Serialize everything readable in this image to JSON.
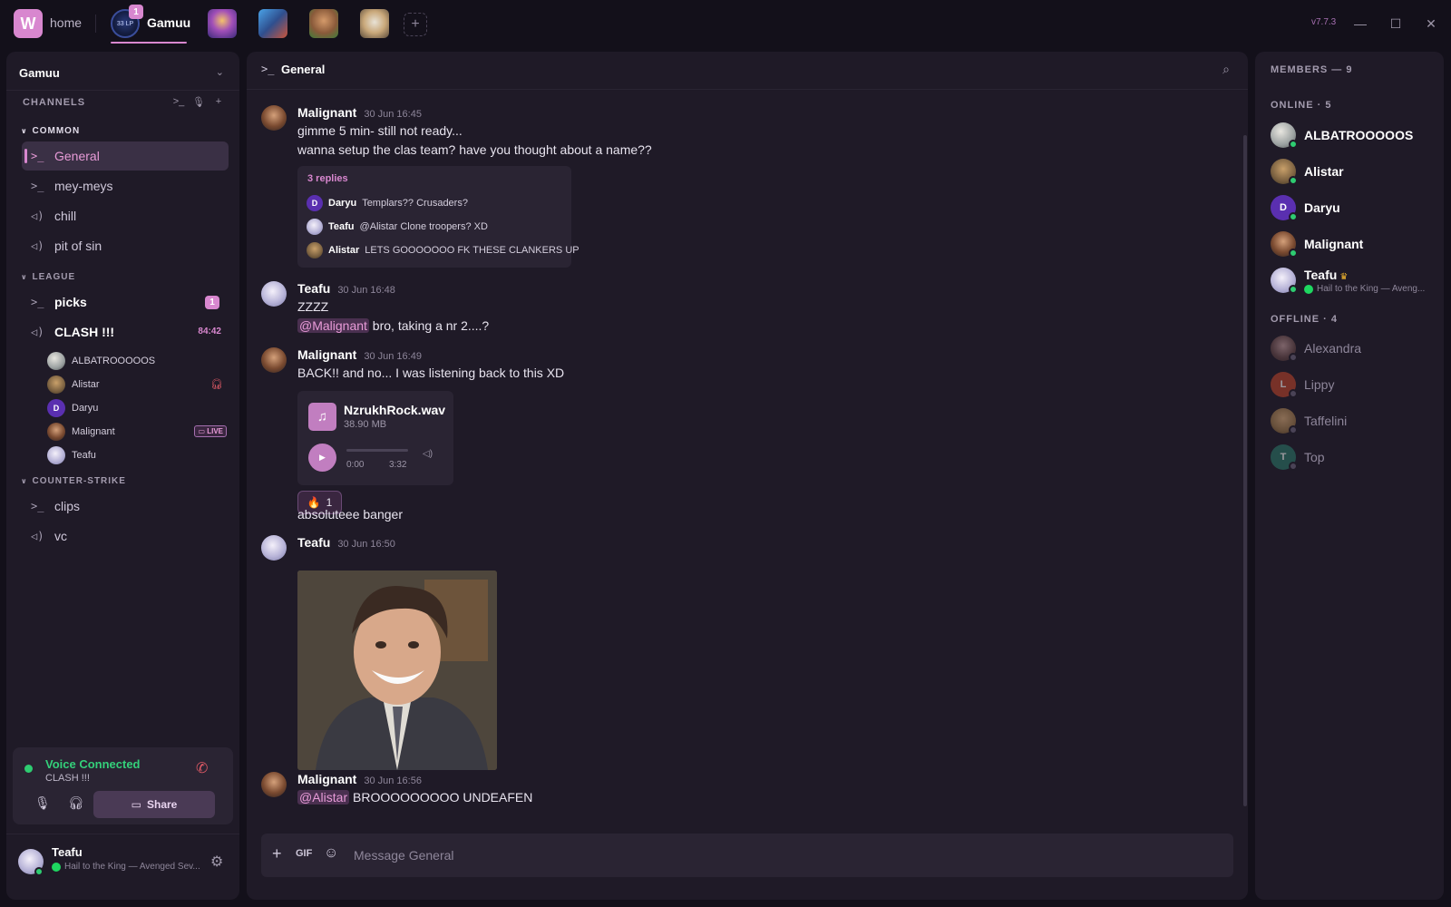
{
  "titlebar": {
    "logo_letter": "W",
    "home_label": "home",
    "active_server": {
      "name": "Gamuu",
      "badge": "1",
      "icon_text": "33 LP"
    },
    "other_servers": [
      "server-2",
      "server-3",
      "server-4",
      "server-5"
    ],
    "add_server": "+",
    "version": "v7.7.3",
    "minimize": "—",
    "maximize": "☐",
    "close": "✕"
  },
  "sidebar": {
    "server_name": "Gamuu",
    "channels_header": "CHANNELS",
    "categories": [
      {
        "name": "COMMON"
      },
      {
        "name": "LEAGUE"
      },
      {
        "name": "COUNTER-STRIKE"
      }
    ],
    "channels": {
      "general": "General",
      "meymeys": "mey-meys",
      "chill": "chill",
      "pitofsin": "pit of sin",
      "picks": "picks",
      "picks_badge": "1",
      "clash": "CLASH !!!",
      "clash_timer": "84:42",
      "clips": "clips",
      "vc": "vc"
    },
    "voice_members": [
      {
        "name": "ALBATROOOOOS"
      },
      {
        "name": "Alistar",
        "status": "deafened"
      },
      {
        "name": "Daryu",
        "initial": "D"
      },
      {
        "name": "Malignant",
        "badge": "LIVE"
      },
      {
        "name": "Teafu"
      }
    ],
    "voice": {
      "status": "Voice Connected",
      "channel": "CLASH !!!",
      "share_label": "Share"
    },
    "user": {
      "name": "Teafu",
      "activity": "Hail to the King — Avenged Sev..."
    }
  },
  "main": {
    "channel_name": "General",
    "messages": [
      {
        "author": "Malignant",
        "date": "30 Jun 16:45",
        "lines": [
          "gimme 5 min- still not ready...",
          "wanna setup the clas team? have you thought about a name??"
        ]
      },
      {
        "author": "Teafu",
        "date": "30 Jun 16:48",
        "line1": "ZZZZ",
        "mention": "@Malignant",
        "line2": " bro, taking a nr 2....?"
      },
      {
        "author": "Malignant",
        "date": "30 Jun 16:49",
        "line1": "BACK!! and no... I was listening back to this XD",
        "after": "absoluteee banger"
      },
      {
        "author": "Teafu",
        "date": "30 Jun 16:50"
      },
      {
        "author": "Malignant",
        "date": "30 Jun 16:56",
        "mention": "@Alistar",
        "line": " BROOOOOOOOO UNDEAFEN"
      }
    ],
    "thread": {
      "count": "3 replies",
      "replies": [
        {
          "author": "Daryu",
          "initial": "D",
          "text": "Templars?? Crusaders?"
        },
        {
          "author": "Teafu",
          "text": "@Alistar Clone troopers? XD"
        },
        {
          "author": "Alistar",
          "text": "LETS GOOOOOOO FK THESE CLANKERS UP"
        }
      ]
    },
    "attachment": {
      "filename": "NzrukhRock.wav",
      "size": "38.90 MB",
      "time_current": "0:00",
      "time_total": "3:32",
      "progress": 0
    },
    "reaction": {
      "emoji": "🔥",
      "count": "1"
    },
    "composer": {
      "gif": "GIF",
      "placeholder": "Message General"
    }
  },
  "members": {
    "header": "MEMBERS — 9",
    "online_label": "ONLINE · 5",
    "offline_label": "OFFLINE · 4",
    "online": [
      {
        "name": "ALBATROOOOOS"
      },
      {
        "name": "Alistar"
      },
      {
        "name": "Daryu",
        "initial": "D"
      },
      {
        "name": "Malignant"
      },
      {
        "name": "Teafu",
        "activity": "Hail to the King — Aveng..."
      }
    ],
    "offline": [
      {
        "name": "Alexandra"
      },
      {
        "name": "Lippy",
        "initial": "L"
      },
      {
        "name": "Taffelini"
      },
      {
        "name": "Top",
        "initial": "T"
      }
    ]
  },
  "colors": {
    "accent": "#d887cf",
    "online": "#2ecc71",
    "background": "#13101a",
    "panel": "#1f1a27"
  },
  "icons": [
    "search-icon",
    "mic-icon",
    "headphones-icon",
    "gear-icon",
    "hangup-icon",
    "music-note-icon",
    "play-icon",
    "volume-icon",
    "plus-icon",
    "emoji-icon",
    "chevron-down-icon",
    "text-channel-icon",
    "voice-channel-icon",
    "crown-icon",
    "spotify-icon",
    "monitor-icon"
  ]
}
